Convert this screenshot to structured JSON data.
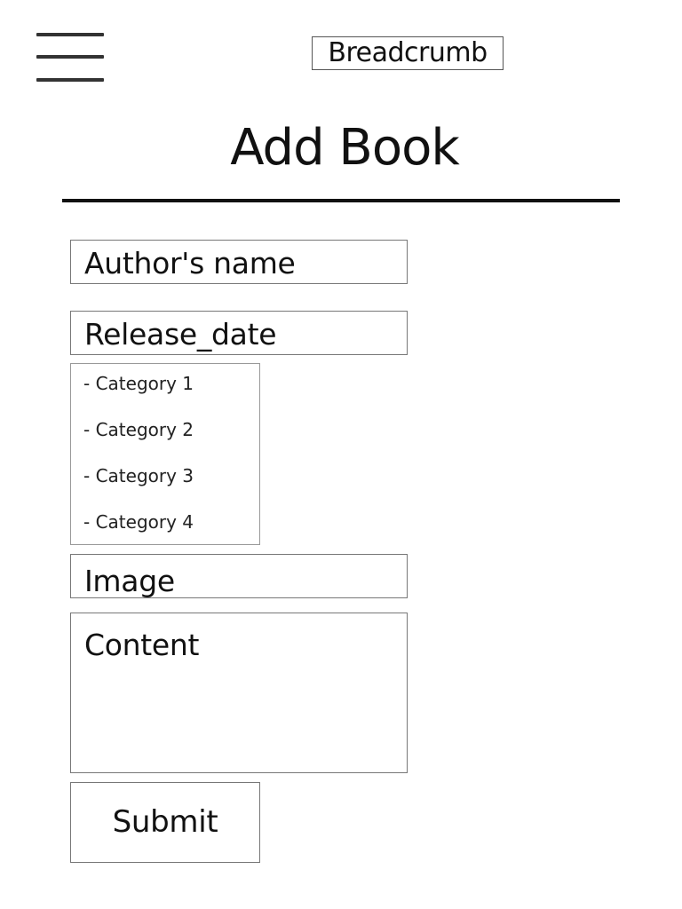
{
  "header": {
    "menu_icon": "hamburger-menu-icon",
    "breadcrumb": "Breadcrumb"
  },
  "title": "Add Book",
  "form": {
    "author_placeholder": "Author's name",
    "release_date_placeholder": "Release_date",
    "categories": [
      "- Category 1",
      "- Category 2",
      "- Category 3",
      "- Category 4"
    ],
    "image_placeholder": "Image",
    "content_placeholder": "Content",
    "submit_label": "Submit"
  },
  "colors": {
    "text": "#111111",
    "border": "#777777",
    "menu_icon": "#333333"
  }
}
